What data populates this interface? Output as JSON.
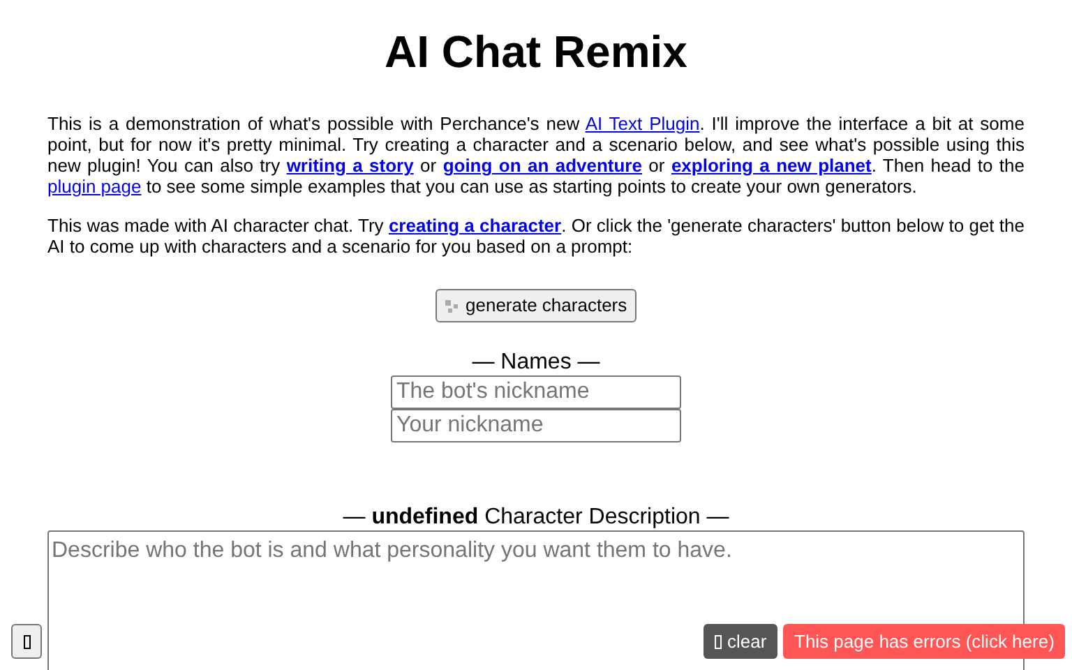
{
  "title": "AI Chat Remix",
  "intro": [
    {
      "text": "This is a demonstration of what's possible with Perchance's new ",
      "kind": "text"
    },
    {
      "text": "AI Text Plugin",
      "kind": "link"
    },
    {
      "text": ". I'll improve the interface a bit at some point, but for now it's pretty minimal. Try creating a character and a scenario below, and see what's possible using this new plugin! You can also try ",
      "kind": "text"
    },
    {
      "text": "writing a story",
      "kind": "bold-link"
    },
    {
      "text": " or ",
      "kind": "text"
    },
    {
      "text": "going on an adventure",
      "kind": "bold-link"
    },
    {
      "text": " or ",
      "kind": "text"
    },
    {
      "text": "exploring a new planet",
      "kind": "bold-link"
    },
    {
      "text": ". Then head to the ",
      "kind": "text"
    },
    {
      "text": "plugin page",
      "kind": "link"
    },
    {
      "text": " to see some simple examples that you can use as starting points to create your own generators.",
      "kind": "text"
    }
  ],
  "note": [
    {
      "text": "This was made with AI character chat. Try ",
      "kind": "text"
    },
    {
      "text": "creating a character",
      "kind": "bold-link"
    },
    {
      "text": ". Or click the 'generate characters' button below to get the AI to come up with characters and a scenario for you based on a prompt:",
      "kind": "text"
    }
  ],
  "generate_button": "generate characters",
  "names": {
    "heading": "— Names —",
    "fields": [
      {
        "placeholder": "The bot's nickname"
      },
      {
        "placeholder": "Your nickname"
      }
    ]
  },
  "description": {
    "heading": "— **undefined** Character Description —",
    "placeholder": "Describe who the bot is and what personality you want them to have."
  },
  "clear_button": "clear",
  "error_button": "This page has errors (click here)"
}
